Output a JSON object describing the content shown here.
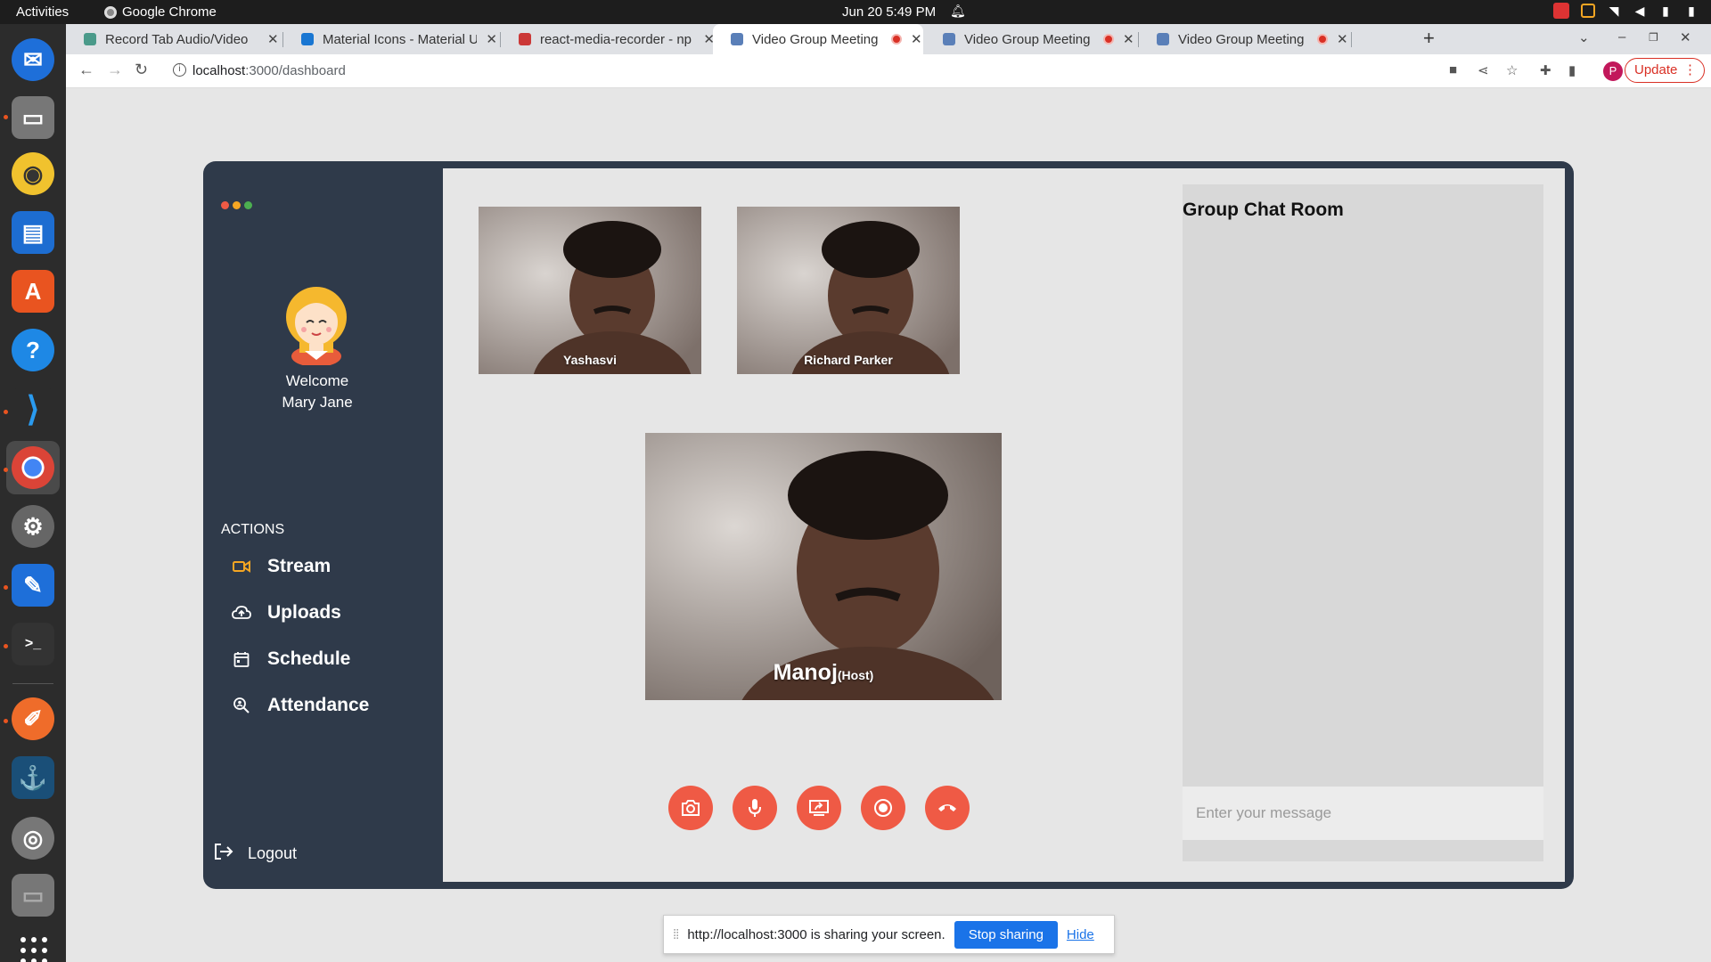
{
  "system": {
    "activities": "Activities",
    "app_name": "Google Chrome",
    "clock": "Jun 20  5:49 PM"
  },
  "browser": {
    "tabs": [
      {
        "label": "Record Tab Audio/Video",
        "recording": false
      },
      {
        "label": "Material Icons - Material U",
        "recording": false
      },
      {
        "label": "react-media-recorder - np",
        "recording": false
      },
      {
        "label": "Video Group Meeting",
        "recording": true
      },
      {
        "label": "Video Group Meeting",
        "recording": true
      },
      {
        "label": "Video Group Meeting",
        "recording": true
      }
    ],
    "url_host": "localhost",
    "url_path": ":3000/dashboard",
    "update_label": "Update",
    "profile_initial": "P"
  },
  "sidebar": {
    "welcome_line1": "Welcome",
    "welcome_line2": "Mary Jane",
    "actions_heading": "ACTIONS",
    "items": [
      {
        "label": "Stream",
        "icon": "video-camera-icon"
      },
      {
        "label": "Uploads",
        "icon": "cloud-upload-icon"
      },
      {
        "label": "Schedule",
        "icon": "calendar-icon"
      },
      {
        "label": "Attendance",
        "icon": "search-person-icon"
      }
    ],
    "logout_label": "Logout"
  },
  "video": {
    "participants": [
      {
        "name": "Yashasvi"
      },
      {
        "name": "Richard Parker"
      }
    ],
    "host_name": "Manoj",
    "host_suffix": "(Host)"
  },
  "controls": [
    "camera-icon",
    "microphone-icon",
    "screen-share-icon",
    "record-icon",
    "hang-up-icon"
  ],
  "chat": {
    "title": "Group Chat Room",
    "placeholder": "Enter your message"
  },
  "sharing": {
    "message": "http://localhost:3000 is sharing your screen.",
    "stop_label": "Stop sharing",
    "hide_label": "Hide"
  },
  "colors": {
    "app_dark": "#2f3a4a",
    "control_red": "#ef5a45",
    "stream_accent": "#f5a623",
    "chrome_blue": "#1a73e8"
  }
}
